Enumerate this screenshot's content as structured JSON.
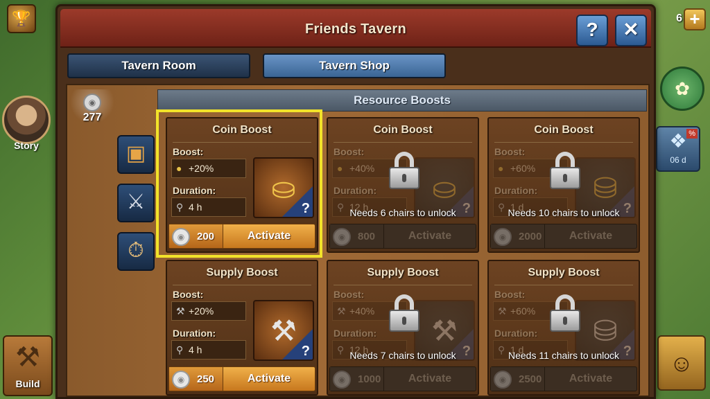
{
  "window": {
    "title": "Friends Tavern",
    "help_label": "?",
    "close_label": "✕"
  },
  "tabs": [
    {
      "label": "Tavern Room"
    },
    {
      "label": "Tavern Shop"
    }
  ],
  "currency": {
    "value": "277"
  },
  "section": {
    "title": "Resource Boosts"
  },
  "boost_stat_labels": {
    "boost": "Boost:",
    "duration": "Duration:"
  },
  "activate_label": "Activate",
  "cards": {
    "coin_1": {
      "title": "Coin Boost",
      "boost": "+20%",
      "duration": "4 h",
      "cost": "200",
      "locked": false
    },
    "coin_2": {
      "title": "Coin Boost",
      "boost": "+40%",
      "duration": "12 h",
      "cost": "800",
      "locked": true,
      "lock_text": "Needs 6 chairs to unlock"
    },
    "coin_3": {
      "title": "Coin Boost",
      "boost": "+60%",
      "duration": "1 d",
      "cost": "2000",
      "locked": true,
      "lock_text": "Needs 10 chairs to unlock"
    },
    "supply_1": {
      "title": "Supply Boost",
      "boost": "+20%",
      "duration": "4 h",
      "cost": "250",
      "locked": false
    },
    "supply_2": {
      "title": "Supply Boost",
      "boost": "+40%",
      "duration": "12 h",
      "cost": "1000",
      "locked": true,
      "lock_text": "Needs 7 chairs to unlock"
    },
    "supply_3": {
      "title": "Supply Boost",
      "boost": "+60%",
      "duration": "1 d",
      "cost": "2500",
      "locked": true,
      "lock_text": "Needs 11 chairs to unlock"
    }
  },
  "hud": {
    "story_label": "Story",
    "build_label": "Build",
    "top_right_count": "6",
    "timer_percent": "%",
    "timer_value": "06 d"
  },
  "colors": {
    "highlight": "#f2e32a",
    "title_bar": "#9c3a2a",
    "activate": "#f0b04a",
    "tab_active": "#6a94c6"
  }
}
